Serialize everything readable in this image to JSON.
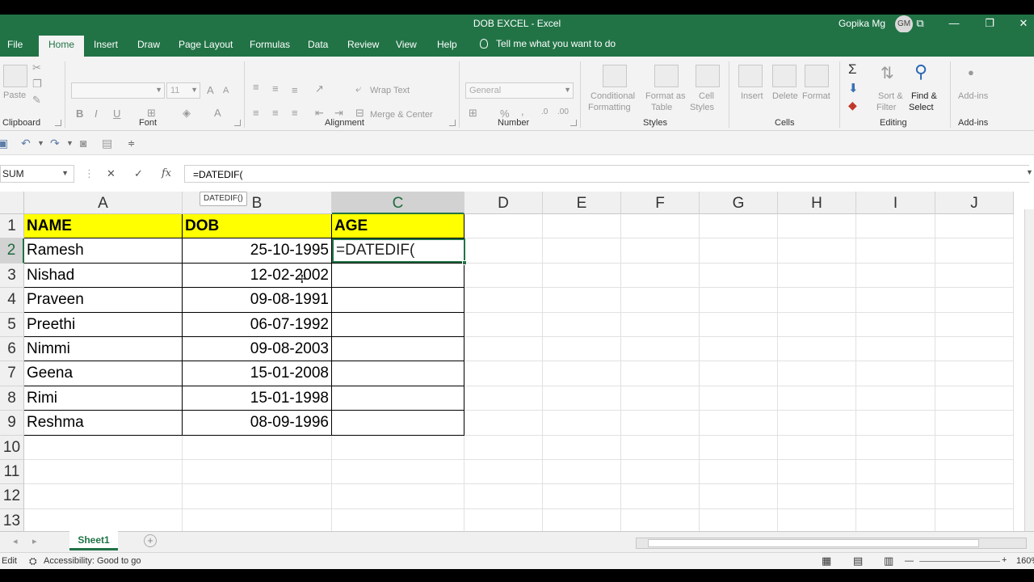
{
  "window": {
    "title": "DOB EXCEL  -  Excel",
    "user_name": "Gopika Mg",
    "user_initials": "GM",
    "btn_ribbon": "⧉",
    "btn_min": "—",
    "btn_max": "❐",
    "btn_close": "✕"
  },
  "tabs": {
    "file": "File",
    "home": "Home",
    "insert": "Insert",
    "draw": "Draw",
    "page_layout": "Page Layout",
    "formulas": "Formulas",
    "data": "Data",
    "review": "Review",
    "view": "View",
    "help": "Help",
    "tell_me": "Tell me what you want to do"
  },
  "ribbon": {
    "clipboard": {
      "label": "Clipboard",
      "paste": "Paste"
    },
    "font": {
      "label": "Font",
      "font_name": "",
      "font_size": "11",
      "bold": "B",
      "italic": "I",
      "underline": "U"
    },
    "alignment": {
      "label": "Alignment",
      "wrap_text": "Wrap Text",
      "merge_center": "Merge & Center"
    },
    "number": {
      "label": "Number",
      "format": "General",
      "percent": "%",
      "comma": ","
    },
    "styles": {
      "label": "Styles",
      "conditional_1": "Conditional",
      "conditional_2": "Formatting",
      "format_as_1": "Format as",
      "format_as_2": "Table",
      "cell_styles_1": "Cell",
      "cell_styles_2": "Styles"
    },
    "cells": {
      "label": "Cells",
      "insert": "Insert",
      "delete": "Delete",
      "format": "Format"
    },
    "editing": {
      "label": "Editing",
      "sort_1": "Sort &",
      "sort_2": "Filter",
      "find_1": "Find &",
      "find_2": "Select"
    },
    "addins": {
      "label": "Add-ins",
      "button": "Add-ins"
    }
  },
  "formula_bar": {
    "name_box": "SUM",
    "cancel": "✕",
    "enter": "✓",
    "fx": "fx",
    "formula": "=DATEDIF("
  },
  "grid": {
    "columns": [
      "A",
      "B",
      "C",
      "D",
      "E",
      "F",
      "G",
      "H",
      "I",
      "J"
    ],
    "rows": [
      "1",
      "2",
      "3",
      "4",
      "5",
      "6",
      "7",
      "8",
      "9",
      "10",
      "11",
      "12",
      "13"
    ],
    "headers": {
      "name": "NAME",
      "dob": "DOB",
      "age": "AGE"
    },
    "records": [
      {
        "name": "Ramesh",
        "dob": "25-10-1995"
      },
      {
        "name": "Nishad",
        "dob": "12-02-2002"
      },
      {
        "name": "Praveen",
        "dob": "09-08-1991"
      },
      {
        "name": "Preethi",
        "dob": "06-07-1992"
      },
      {
        "name": "Nimmi",
        "dob": "09-08-2003"
      },
      {
        "name": "Geena",
        "dob": "15-01-2008"
      },
      {
        "name": "Rimi",
        "dob": "15-01-1998"
      },
      {
        "name": "Reshma",
        "dob": "08-09-1996"
      }
    ],
    "active_cell_value": "=DATEDIF(",
    "tooltip": "DATEDIF()"
  },
  "sheet": {
    "tab": "Sheet1",
    "add": "+"
  },
  "status": {
    "mode": "Edit",
    "accessibility": "Accessibility: Good to go",
    "zoom": "160%"
  },
  "colors": {
    "accent": "#217346",
    "header_fill": "#ffff00"
  }
}
